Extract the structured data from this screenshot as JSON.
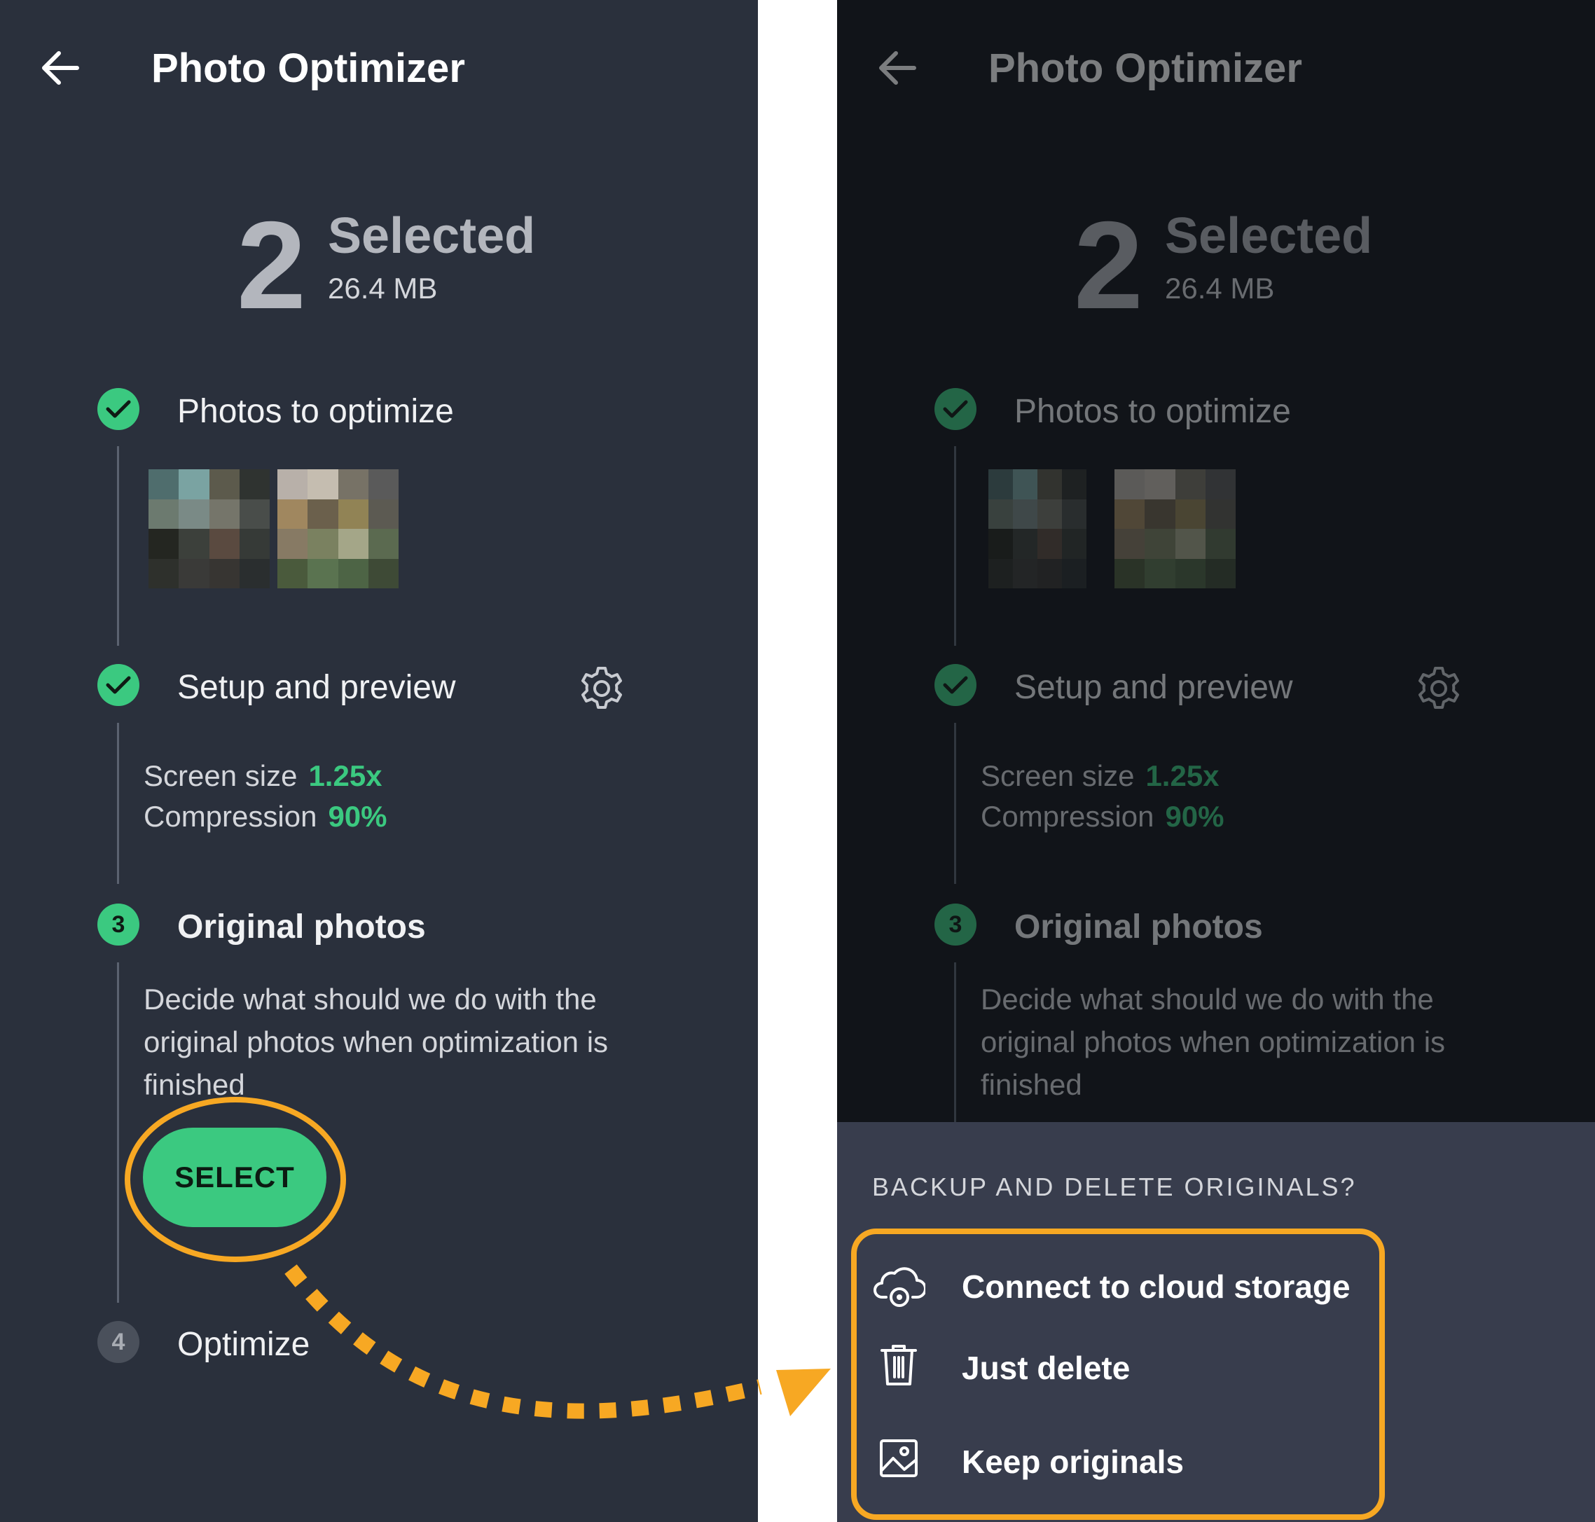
{
  "app": {
    "title": "Photo Optimizer"
  },
  "summary": {
    "count": "2",
    "selected_label": "Selected",
    "size": "26.4 MB"
  },
  "steps": [
    {
      "number": "✓",
      "title": "Photos to optimize",
      "status": "done"
    },
    {
      "number": "✓",
      "title": "Setup and preview",
      "status": "done"
    },
    {
      "number": "3",
      "title": "Original photos",
      "status": "active"
    },
    {
      "number": "4",
      "title": "Optimize",
      "status": "pending"
    }
  ],
  "settings": {
    "screen_size_label": "Screen size",
    "screen_size_value": "1.25x",
    "compression_label": "Compression",
    "compression_value": "90%"
  },
  "original_photos": {
    "description": "Decide what should we do with the original photos when optimization is finished",
    "select_label": "SELECT"
  },
  "sheet": {
    "title": "BACKUP AND DELETE ORIGINALS?",
    "options": [
      {
        "label": "Connect to cloud storage",
        "icon": "cloud-settings-icon"
      },
      {
        "label": "Just delete",
        "icon": "trash-icon"
      },
      {
        "label": "Keep originals",
        "icon": "image-icon"
      }
    ]
  },
  "colors": {
    "accent": "#3bc980",
    "highlight": "#f7a823",
    "panel_bg": "#2a303c",
    "dimmed_bg": "#111419",
    "sheet_bg": "#383d4d"
  }
}
